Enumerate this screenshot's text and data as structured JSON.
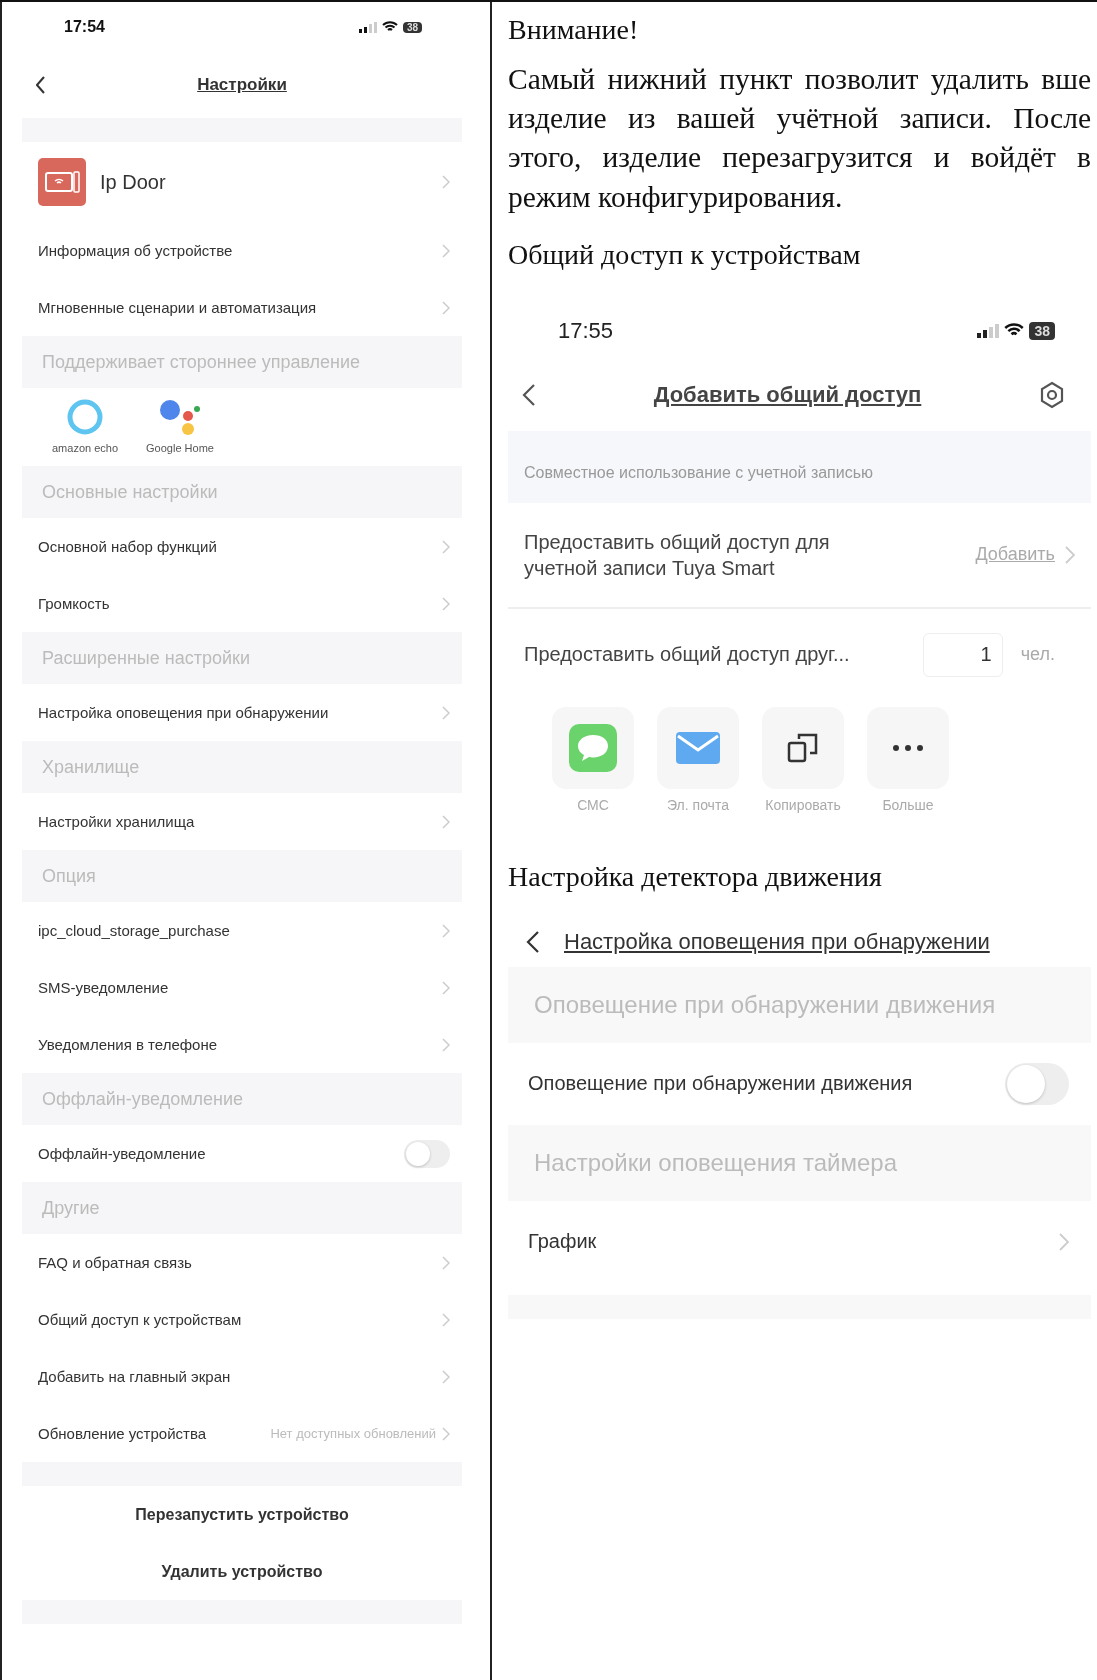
{
  "left_phone": {
    "status_time": "17:54",
    "battery": "38",
    "title": "Настройки",
    "items": [
      {
        "kind": "spacer"
      },
      {
        "kind": "device",
        "label": "Ip Door"
      },
      {
        "kind": "row",
        "label": "Информация об устройстве"
      },
      {
        "kind": "row",
        "label": "Мгновенные сценарии и автоматизация"
      },
      {
        "kind": "section",
        "label": "Поддерживает стороннее управление"
      },
      {
        "kind": "logos",
        "labels": [
          "amazon echo",
          "Google Home"
        ]
      },
      {
        "kind": "section",
        "label": "Основные настройки"
      },
      {
        "kind": "row",
        "label": "Основной набор функций"
      },
      {
        "kind": "row",
        "label": "Громкость"
      },
      {
        "kind": "section",
        "label": "Расширенные настройки"
      },
      {
        "kind": "row",
        "label": "Настройка оповещения при обнаружении"
      },
      {
        "kind": "section",
        "label": "Хранилище"
      },
      {
        "kind": "row",
        "label": "Настройки хранилища"
      },
      {
        "kind": "section",
        "label": "Опция"
      },
      {
        "kind": "row",
        "label": "ipc_cloud_storage_purchase"
      },
      {
        "kind": "row",
        "label": "SMS-уведомление"
      },
      {
        "kind": "row",
        "label": "Уведомления в телефоне"
      },
      {
        "kind": "section",
        "label": "Оффлайн-уведомление"
      },
      {
        "kind": "toggle",
        "label": "Оффлайн-уведомление",
        "on": false
      },
      {
        "kind": "section",
        "label": "Другие"
      },
      {
        "kind": "row",
        "label": "FAQ и обратная связь"
      },
      {
        "kind": "row",
        "label": "Общий доступ к устройствам"
      },
      {
        "kind": "row",
        "label": "Добавить на главный экран"
      },
      {
        "kind": "row",
        "label": "Обновление устройства",
        "value": "Нет доступных обновлений"
      },
      {
        "kind": "spacer"
      },
      {
        "kind": "action",
        "label": "Перезапустить устройство"
      },
      {
        "kind": "action",
        "label": "Удалить устройство"
      },
      {
        "kind": "spacer"
      }
    ]
  },
  "article": {
    "warning_heading": "Внимание!",
    "warning_text": "Самый нижний пункт позволит удалить вше изделие из вашей учётной записи. После этого, изделие перезагрузится и войдёт в режим конфигурирования.",
    "share_heading": "Общий доступ к устройствам",
    "share_screen": {
      "status_time": "17:55",
      "battery": "38",
      "title": "Добавить общий доступ",
      "section": "Совместное использование с учетной записью",
      "account_row": {
        "label": "Предоставить общий доступ для учетной записи Tuya Smart",
        "action": "Добавить"
      },
      "count_row": {
        "label": "Предоставить общий доступ друг...",
        "value": "1",
        "unit": "чел."
      },
      "share_options": [
        {
          "kind": "sms",
          "label": "СМС"
        },
        {
          "kind": "mail",
          "label": "Эл. почта"
        },
        {
          "kind": "copy",
          "label": "Копировать"
        },
        {
          "kind": "more",
          "label": "Больше"
        }
      ]
    },
    "motion_heading": "Настройка детектора движения",
    "motion_screen": {
      "title": "Настройка оповещения при обнаружении",
      "items": [
        {
          "kind": "section",
          "label": "Оповещение при обнаружении движения"
        },
        {
          "kind": "toggle",
          "label": "Оповещение при обнаружении движения",
          "on": false
        },
        {
          "kind": "section",
          "label": "Настройки оповещения таймера"
        },
        {
          "kind": "row",
          "label": "График"
        },
        {
          "kind": "spacer"
        }
      ]
    }
  }
}
